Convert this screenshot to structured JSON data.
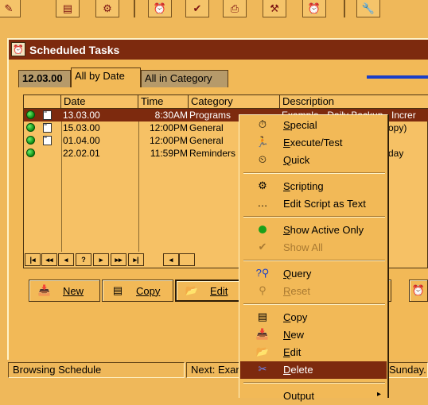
{
  "window": {
    "title": "Scheduled Tasks"
  },
  "tabs": [
    {
      "label": "12.03.00"
    },
    {
      "label": "All by Date"
    },
    {
      "label": "All in Category"
    }
  ],
  "columns": [
    "Date",
    "Time",
    "Category",
    "Description"
  ],
  "rows": [
    {
      "date": "13.03.00",
      "time": "8:30AM",
      "category": "Programs",
      "description": "Example - Daily Backup - Increr"
    },
    {
      "date": "15.03.00",
      "time": "12:00PM",
      "category": "General",
      "description": "opy)"
    },
    {
      "date": "01.04.00",
      "time": "12:00PM",
      "category": "General",
      "description": ""
    },
    {
      "date": "22.02.01",
      "time": "11:59PM",
      "category": "Reminders",
      "description": "day"
    }
  ],
  "buttons": {
    "new": "New",
    "copy": "Copy",
    "edit": "Edit"
  },
  "status": {
    "left": "Browsing Schedule",
    "middle": "Next: Exan",
    "right": "Sunday."
  },
  "menu": [
    {
      "label": "Special",
      "icon": "special-icon"
    },
    {
      "label": "Execute/Test",
      "icon": "run-icon"
    },
    {
      "label": "Quick",
      "icon": "quick-icon"
    },
    {
      "label": "Scripting",
      "icon": "script-icon"
    },
    {
      "label": "Edit Script as Text",
      "icon": "dots-icon"
    },
    {
      "label": "Show Active Only",
      "icon": "green-dot-icon"
    },
    {
      "label": "Show All",
      "icon": "check-icon",
      "disabled": true
    },
    {
      "label": "Query",
      "icon": "query-icon"
    },
    {
      "label": "Reset",
      "icon": "reset-icon",
      "disabled": true
    },
    {
      "label": "Copy",
      "icon": "copy-icon"
    },
    {
      "label": "New",
      "icon": "new-icon"
    },
    {
      "label": "Edit",
      "icon": "edit-icon"
    },
    {
      "label": "Delete",
      "icon": "delete-icon",
      "selected": true
    },
    {
      "label": "Output",
      "icon": ""
    }
  ],
  "colors": {
    "accent": "#7d2a0e",
    "background": "#efb85a",
    "highlight_line": "#1a3ec8"
  }
}
